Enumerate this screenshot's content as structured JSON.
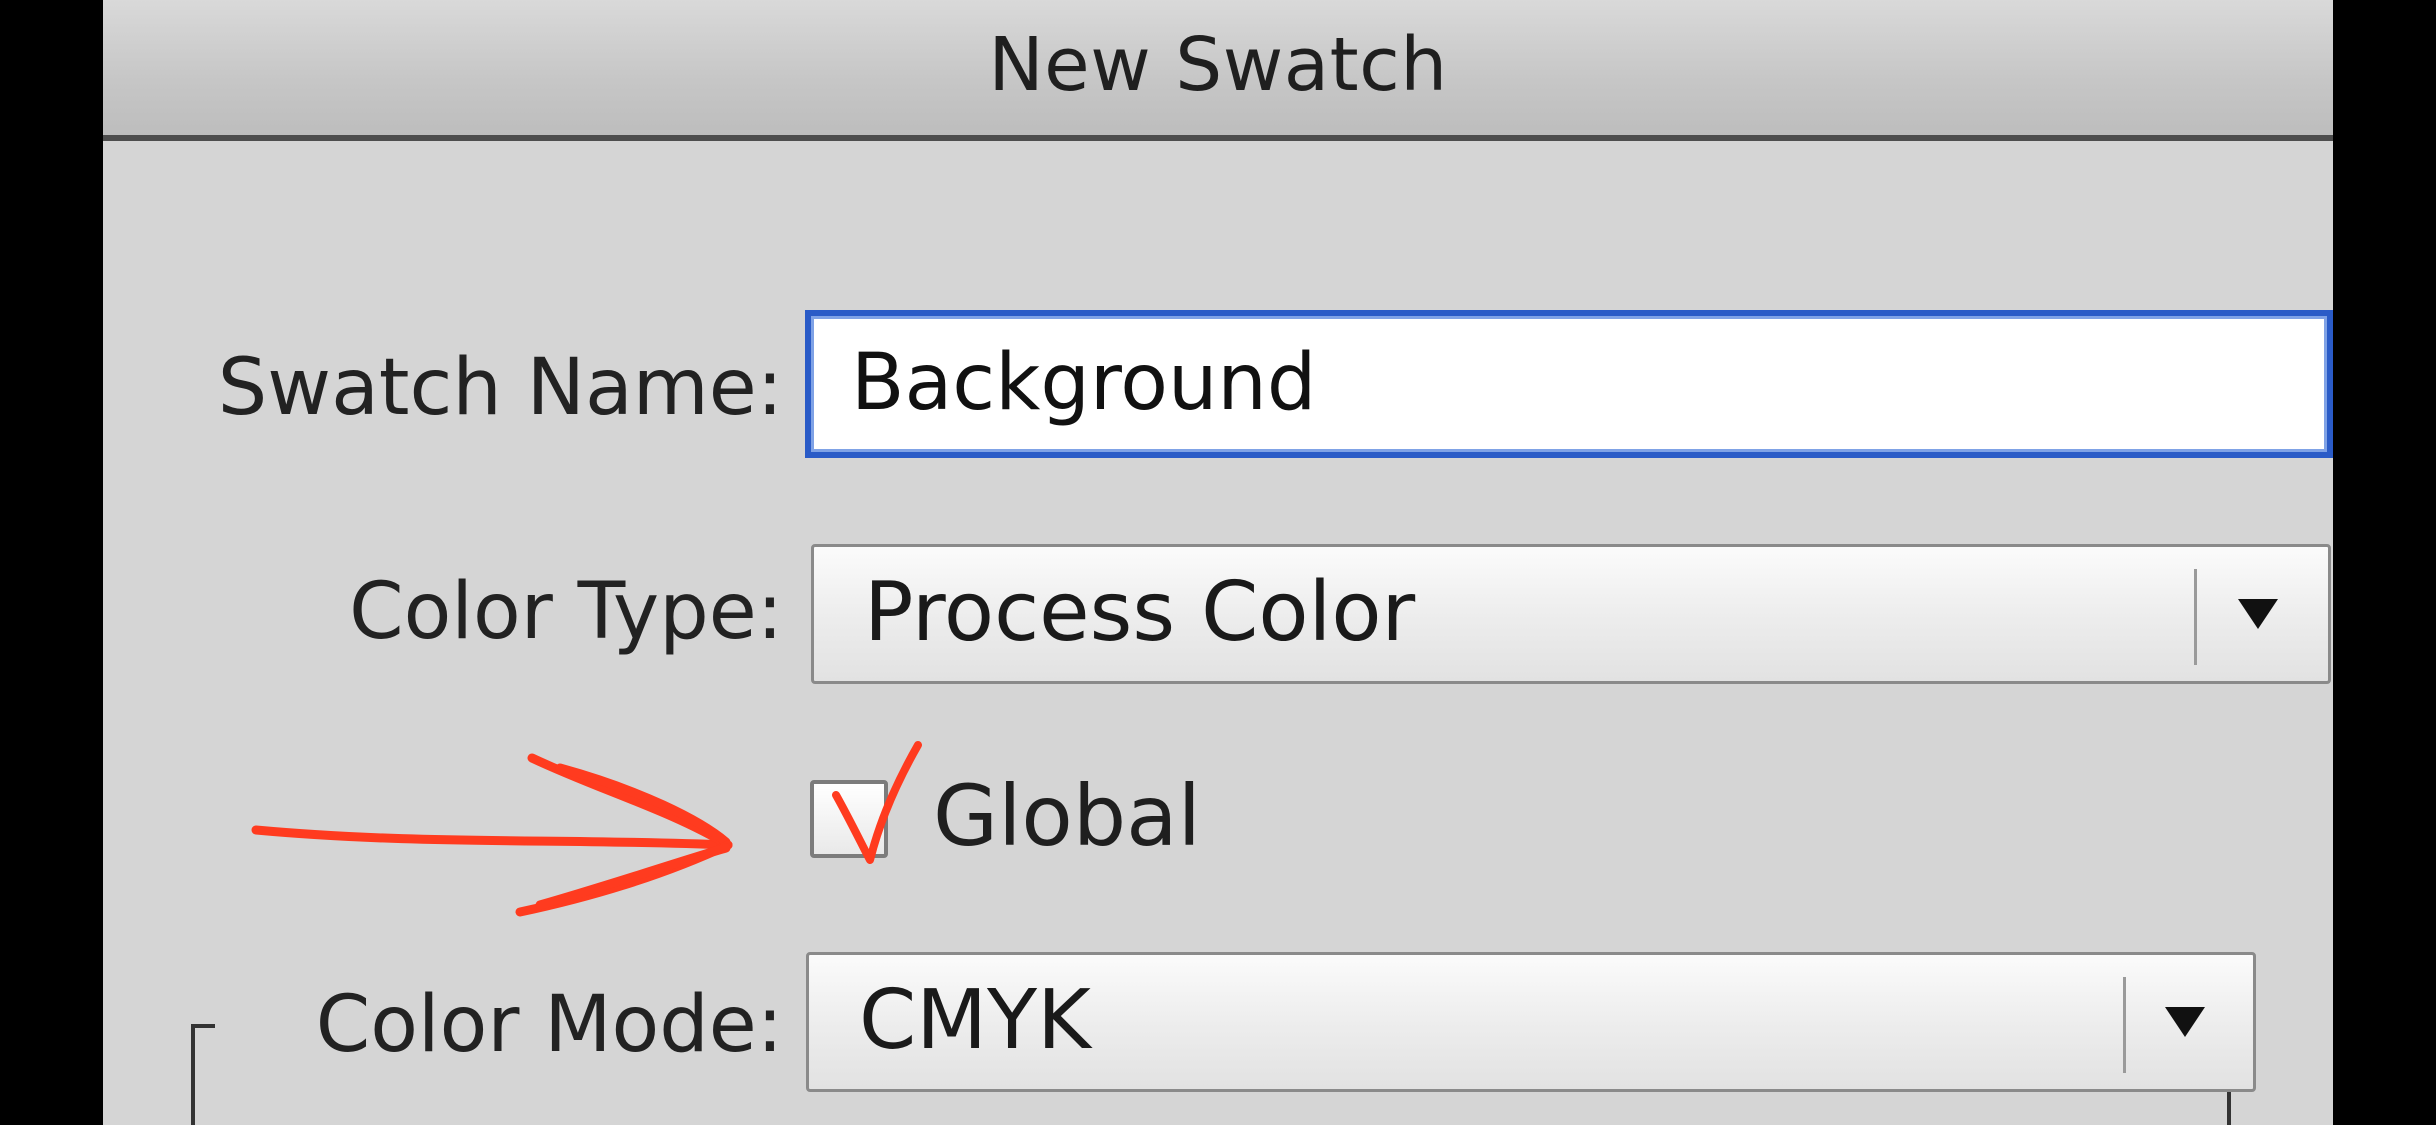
{
  "dialog": {
    "title": "New Swatch"
  },
  "fields": {
    "swatch_name_label": "Swatch Name:",
    "swatch_name_value": "Background",
    "color_type_label": "Color Type:",
    "color_type_value": "Process Color",
    "global_label": "Global",
    "global_checked": false,
    "color_mode_label": "Color Mode:",
    "color_mode_value": "CMYK"
  },
  "icons": {
    "dropdown": "chevron-down-icon",
    "annotation_arrow": "red-arrow-icon",
    "annotation_check": "red-checkmark-icon"
  },
  "colors": {
    "focus_ring": "#2a5bc7",
    "annotation": "#ff3b1f",
    "dialog_bg": "#d5d5d5"
  }
}
